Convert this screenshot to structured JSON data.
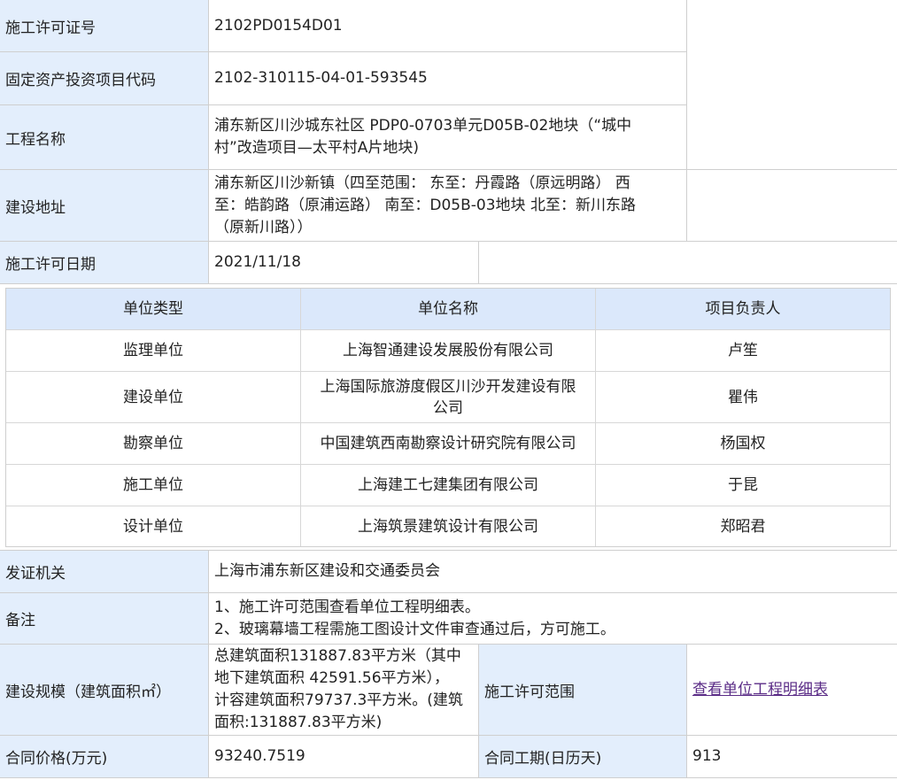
{
  "rows": {
    "permit_no": {
      "label": "施工许可证号",
      "value": "2102PD0154D01"
    },
    "project_code": {
      "label": "固定资产投资项目代码",
      "value": "2102-310115-04-01-593545"
    },
    "project_name": {
      "label": "工程名称",
      "value_lines": [
        "浦东新区川沙城东社区 PDP0-0703单元D05B-02地块（“城中",
        "村”改造项目—太平村A片地块)"
      ]
    },
    "address": {
      "label": "建设地址",
      "value_lines": [
        "浦东新区川沙新镇（四至范围： 东至：丹霞路（原远明路） 西",
        "至：皓韵路（原浦运路） 南至：D05B-03地块 北至：新川东路",
        "（原新川路））"
      ]
    },
    "permit_date": {
      "label": "施工许可日期",
      "value": "2021/11/18"
    },
    "issuer": {
      "label": "发证机关",
      "value": "上海市浦东新区建设和交通委员会"
    },
    "remarks": {
      "label": "备注",
      "value_lines": [
        "1、施工许可范围查看单位工程明细表。",
        "2、玻璃幕墙工程需施工图设计文件审查通过后，方可施工。"
      ]
    },
    "scale": {
      "label": "建设规模（建筑面积㎡）",
      "value_lines": [
        "总建筑面积131887.83平方米（其中",
        "地下建筑面积 42591.56平方米），",
        "计容建筑面积79737.3平方米。(建筑",
        "面积:131887.83平方米)"
      ],
      "scope_label": "施工许可范围",
      "scope_link": "查看单位工程明细表"
    },
    "contract": {
      "label": "合同价格(万元)",
      "value": "93240.7519",
      "period_label": "合同工期(日历天)",
      "period_value": "913"
    }
  },
  "units_table": {
    "headers": [
      "单位类型",
      "单位名称",
      "项目负责人"
    ],
    "rows": [
      {
        "type": "监理单位",
        "name_lines": [
          "上海智通建设发展股份有限公司"
        ],
        "person": "卢笙"
      },
      {
        "type": "建设单位",
        "name_lines": [
          "上海国际旅游度假区川沙开发建设有限",
          "公司"
        ],
        "person": "瞿伟"
      },
      {
        "type": "勘察单位",
        "name_lines": [
          "中国建筑西南勘察设计研究院有限公司"
        ],
        "person": "杨国权"
      },
      {
        "type": "施工单位",
        "name_lines": [
          "上海建工七建集团有限公司"
        ],
        "person": "于昆"
      },
      {
        "type": "设计单位",
        "name_lines": [
          "上海筑景建筑设计有限公司"
        ],
        "person": "郑昭君"
      }
    ]
  },
  "colors": {
    "label_bg": "#e3eefc",
    "header_bg": "#dbe8fb",
    "border": "#cfcfcf",
    "link": "#5a2b86"
  }
}
